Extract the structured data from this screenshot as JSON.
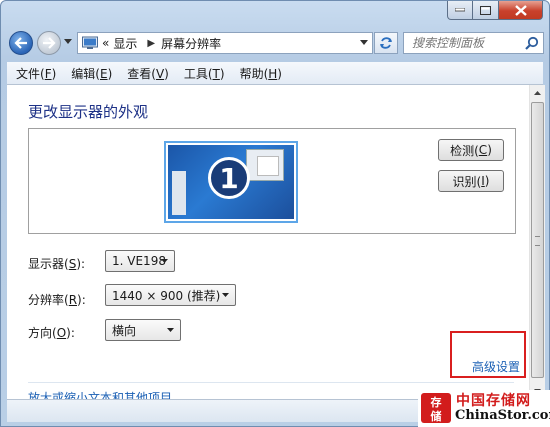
{
  "window": {
    "breadcrumb_prefix": "«",
    "breadcrumb": [
      "显示",
      "屏幕分辨率"
    ],
    "search_placeholder": "搜索控制面板"
  },
  "menu": [
    {
      "label": "文件(",
      "key": "F",
      "tail": ")"
    },
    {
      "label": "编辑(",
      "key": "E",
      "tail": ")"
    },
    {
      "label": "查看(",
      "key": "V",
      "tail": ")"
    },
    {
      "label": "工具(",
      "key": "T",
      "tail": ")"
    },
    {
      "label": "帮助(",
      "key": "H",
      "tail": ")"
    }
  ],
  "main": {
    "title": "更改显示器的外观",
    "monitor_number": "1",
    "detect": {
      "label": "检测(",
      "key": "C",
      "tail": ")"
    },
    "identify": {
      "label": "识别(",
      "key": "I",
      "tail": ")"
    },
    "display_label": {
      "label": "显示器(",
      "key": "S",
      "tail": "):"
    },
    "display_value": "1. VE198",
    "resolution_label": {
      "label": "分辨率(",
      "key": "R",
      "tail": "):"
    },
    "resolution_value": "1440 × 900 (推荐)",
    "orientation_label": {
      "label": "方向(",
      "key": "O",
      "tail": "):"
    },
    "orientation_value": "横向",
    "advanced_link": "高级设置",
    "text_size_link": "放大或缩小文本和其他项目"
  },
  "watermark": {
    "cn": "中国存储网",
    "en": "ChinaStor.com",
    "logo_text": "存储"
  },
  "colors": {
    "title": "#1e3287",
    "link": "#1a5fb4",
    "highlight": "#d91f1f",
    "watermark_red": "#d21c1c"
  }
}
